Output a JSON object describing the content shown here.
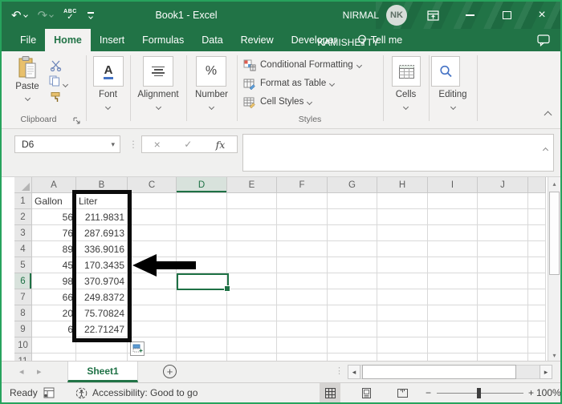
{
  "window": {
    "title": "Book1  -  Excel",
    "user": "NIRMAL KAMISHETTY",
    "initials": "NK"
  },
  "icons": {
    "undo": "↶",
    "redo": "↷",
    "spell_abc": "ABC",
    "spell_check": "✓",
    "name_box_arrow": "▾",
    "dots_vertical": "⋮",
    "cancel": "×",
    "enter": "✓",
    "fx": "fx",
    "nav_left": "◂",
    "nav_right": "▸",
    "scroll_left": "◂",
    "scroll_right": "▸",
    "scroll_up": "▴",
    "scroll_down": "▾",
    "minus": "−",
    "plus": "+",
    "close": "×",
    "new_sheet": "+",
    "percent": "%",
    "font_letter": "A",
    "autofill_plus": "+"
  },
  "tabs": [
    "File",
    "Home",
    "Insert",
    "Formulas",
    "Data",
    "Review",
    "Developer",
    "Tell me"
  ],
  "active_tab": "Home",
  "ribbon": {
    "paste_label": "Paste",
    "clipboard_group": "Clipboard",
    "font_group": "Font",
    "alignment_group": "Alignment",
    "number_group": "Number",
    "styles_items": [
      "Conditional Formatting",
      "Format as Table",
      "Cell Styles"
    ],
    "styles_group": "Styles",
    "cells_group": "Cells",
    "editing_group": "Editing"
  },
  "formula_bar": {
    "name_box": "D6",
    "formula_value": ""
  },
  "sheet": {
    "columns": [
      "A",
      "B",
      "C",
      "D",
      "E",
      "F",
      "G",
      "H",
      "I",
      "J",
      ""
    ],
    "row_count": 11,
    "active": {
      "col": "D",
      "row": 6,
      "cell": "D6"
    },
    "cells": {
      "A1": "Gallon",
      "B1": "Liter",
      "A2": "56",
      "B2": "211.9831",
      "A3": "76",
      "B3": "287.6913",
      "A4": "89",
      "B4": "336.9016",
      "A5": "45",
      "B5": "170.3435",
      "A6": "98",
      "B6": "370.9704",
      "A7": "66",
      "B7": "249.8372",
      "A8": "20",
      "B8": "75.70824",
      "A9": "6",
      "B9": "22.71247"
    }
  },
  "sheet_tabs": {
    "active": "Sheet1"
  },
  "status_bar": {
    "mode": "Ready",
    "accessibility": "Accessibility: Good to go",
    "zoom": "100%"
  }
}
